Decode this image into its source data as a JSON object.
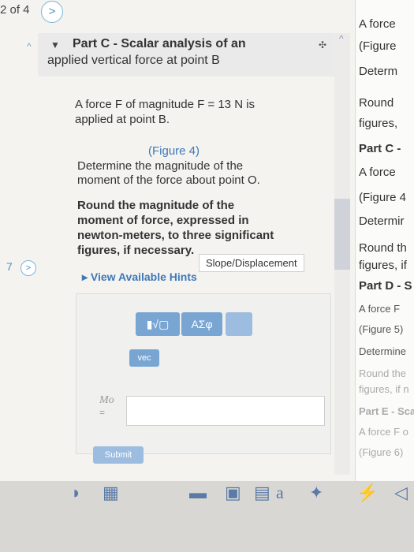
{
  "pager": {
    "label": "2 of 4",
    "next_glyph": ">"
  },
  "part_c": {
    "title": "Part C - Scalar analysis of an",
    "subtitle": "applied vertical force at point B",
    "line1": "A force F of magnitude F = 13 N is",
    "line2": "applied at point B.",
    "figure_link": "(Figure 4)",
    "q1": "Determine the magnitude of the",
    "q2": "moment of the force about point O.",
    "r1": "Round the magnitude of the",
    "r2": "moment of force, expressed in",
    "r3": "newton-meters, to three significant",
    "r4": "figures, if necessary.",
    "hints": "View Available Hints",
    "tooltip": "Slope/Displacement"
  },
  "toolbar": {
    "templates_label": "▮√▢",
    "symbols_label": "ΑΣφ",
    "vec_label": "vec"
  },
  "answer": {
    "label": "Mo",
    "equals": "=",
    "value": "",
    "submit": "Submit"
  },
  "right_panel": [
    {
      "text": "A force",
      "bold": false
    },
    {
      "text": "(Figure",
      "bold": false
    },
    {
      "text": "Determ",
      "bold": false
    },
    {
      "text": "Round",
      "bold": false
    },
    {
      "text": "figures,",
      "bold": false
    },
    {
      "text": "Part C -",
      "bold": true
    },
    {
      "text": "A force",
      "bold": false
    },
    {
      "text": "(Figure 4",
      "bold": false
    },
    {
      "text": "Determir",
      "bold": false
    },
    {
      "text": "Round th",
      "bold": false
    },
    {
      "text": "figures, if",
      "bold": false
    },
    {
      "text": "Part D - S",
      "bold": true
    },
    {
      "text": "A force F",
      "bold": false
    },
    {
      "text": "(Figure 5)",
      "bold": false
    },
    {
      "text": "Determine",
      "bold": false
    },
    {
      "text": "Round the",
      "bold": false
    },
    {
      "text": "figures, if n",
      "bold": false
    },
    {
      "text": "Part E - Sca",
      "bold": true
    },
    {
      "text": "A force F o",
      "bold": false
    },
    {
      "text": "(Figure 6)",
      "bold": false
    }
  ],
  "dock_letter": "a"
}
